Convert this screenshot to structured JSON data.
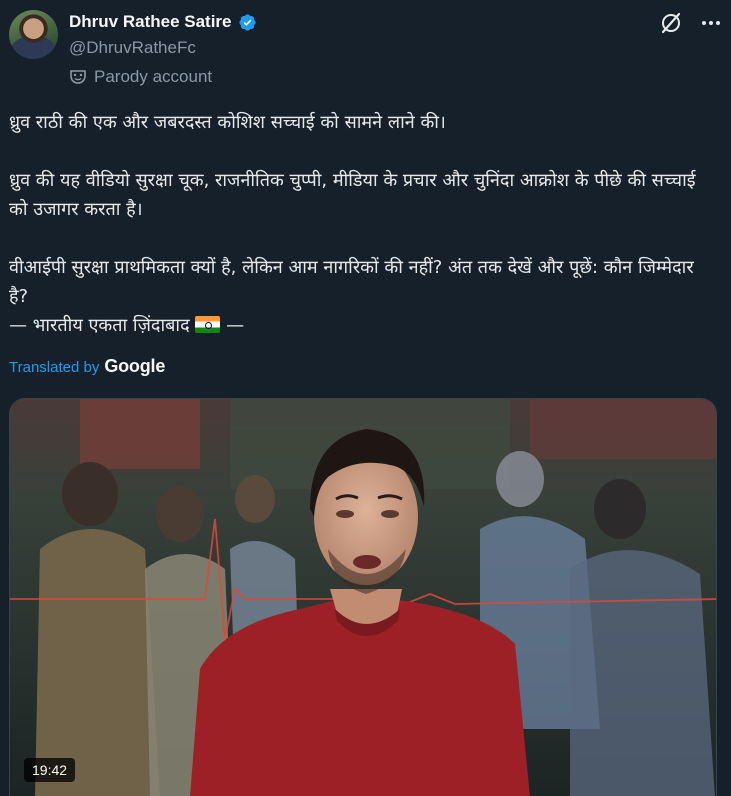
{
  "author": {
    "display_name": "Dhruv Rathee Satire",
    "handle": "@DhruvRatheFc",
    "verified": true,
    "label_icon": "parody-mask-icon",
    "label": "Parody account",
    "avatar_alt": "profile photo"
  },
  "header_icons": [
    "grok-icon",
    "more-options-icon"
  ],
  "tweet": {
    "paragraphs": [
      "ध्रुव राठी की एक और जबरदस्त कोशिश सच्चाई को सामने लाने की।",
      "ध्रुव की यह वीडियो सुरक्षा चूक, राजनीतिक चुप्पी, मीडिया के प्रचार और चुनिंदा आक्रोश के पीछे की सच्चाई को उजागर करता है।",
      "वीआईपी सुरक्षा प्राथमिकता क्यों है, लेकिन आम नागरिकों की नहीं? अंत तक देखें और पूछें: कौन जिम्मेदार है?"
    ],
    "closing_prefix": "— भारतीय एकता ज़िंदाबाद",
    "closing_suffix": "—",
    "closing_emoji": "india-flag"
  },
  "translation": {
    "label": "Translated by",
    "provider": "Google"
  },
  "media": {
    "type": "video",
    "duration": "19:42"
  },
  "colors": {
    "background": "#15202b",
    "text": "#e7e9ea",
    "secondary": "#8b98a5",
    "accent": "#1d9bf0",
    "border": "#38444d"
  }
}
